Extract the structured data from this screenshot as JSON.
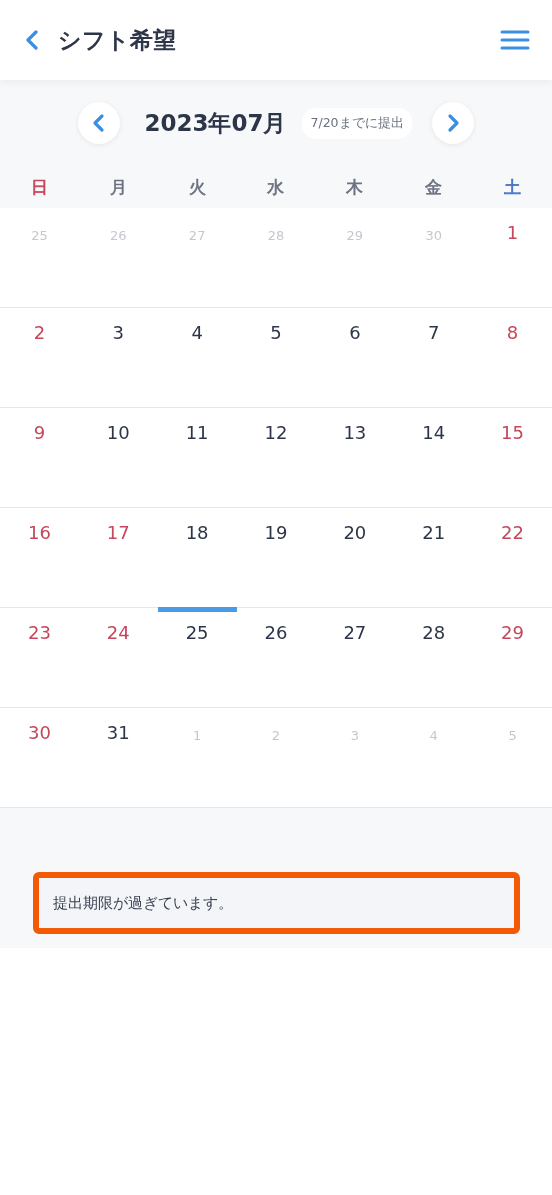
{
  "header": {
    "title": "シフト希望"
  },
  "month_nav": {
    "month": "2023年07月",
    "deadline": "7/20までに提出"
  },
  "weekdays": [
    {
      "label": "日",
      "color": "#c5475a"
    },
    {
      "label": "月",
      "color": "#6b7280"
    },
    {
      "label": "火",
      "color": "#6b7280"
    },
    {
      "label": "水",
      "color": "#6b7280"
    },
    {
      "label": "木",
      "color": "#6b7280"
    },
    {
      "label": "金",
      "color": "#6b7280"
    },
    {
      "label": "土",
      "color": "#3f6fc2"
    }
  ],
  "weeks": [
    [
      {
        "label": "25",
        "kind": "other",
        "color": "#c4c8ce",
        "today": false
      },
      {
        "label": "26",
        "kind": "other",
        "color": "#c4c8ce",
        "today": false
      },
      {
        "label": "27",
        "kind": "other",
        "color": "#c4c8ce",
        "today": false
      },
      {
        "label": "28",
        "kind": "other",
        "color": "#c4c8ce",
        "today": false
      },
      {
        "label": "29",
        "kind": "other",
        "color": "#c4c8ce",
        "today": false
      },
      {
        "label": "30",
        "kind": "other",
        "color": "#c4c8ce",
        "today": false
      },
      {
        "label": "1",
        "kind": "current",
        "color": "#c5475a",
        "today": false
      }
    ],
    [
      {
        "label": "2",
        "kind": "current",
        "color": "#c5475a",
        "today": false
      },
      {
        "label": "3",
        "kind": "current",
        "color": "#2d3648",
        "today": false
      },
      {
        "label": "4",
        "kind": "current",
        "color": "#2d3648",
        "today": false
      },
      {
        "label": "5",
        "kind": "current",
        "color": "#2d3648",
        "today": false
      },
      {
        "label": "6",
        "kind": "current",
        "color": "#2d3648",
        "today": false
      },
      {
        "label": "7",
        "kind": "current",
        "color": "#2d3648",
        "today": false
      },
      {
        "label": "8",
        "kind": "current",
        "color": "#c5475a",
        "today": false
      }
    ],
    [
      {
        "label": "9",
        "kind": "current",
        "color": "#c5475a",
        "today": false
      },
      {
        "label": "10",
        "kind": "current",
        "color": "#2d3648",
        "today": false
      },
      {
        "label": "11",
        "kind": "current",
        "color": "#2d3648",
        "today": false
      },
      {
        "label": "12",
        "kind": "current",
        "color": "#2d3648",
        "today": false
      },
      {
        "label": "13",
        "kind": "current",
        "color": "#2d3648",
        "today": false
      },
      {
        "label": "14",
        "kind": "current",
        "color": "#2d3648",
        "today": false
      },
      {
        "label": "15",
        "kind": "current",
        "color": "#c5475a",
        "today": false
      }
    ],
    [
      {
        "label": "16",
        "kind": "current",
        "color": "#c5475a",
        "today": false
      },
      {
        "label": "17",
        "kind": "current",
        "color": "#c5475a",
        "today": false
      },
      {
        "label": "18",
        "kind": "current",
        "color": "#2d3648",
        "today": false
      },
      {
        "label": "19",
        "kind": "current",
        "color": "#2d3648",
        "today": false
      },
      {
        "label": "20",
        "kind": "current",
        "color": "#2d3648",
        "today": false
      },
      {
        "label": "21",
        "kind": "current",
        "color": "#2d3648",
        "today": false
      },
      {
        "label": "22",
        "kind": "current",
        "color": "#c5475a",
        "today": false
      }
    ],
    [
      {
        "label": "23",
        "kind": "current",
        "color": "#c5475a",
        "today": false
      },
      {
        "label": "24",
        "kind": "current",
        "color": "#c5475a",
        "today": false
      },
      {
        "label": "25",
        "kind": "current",
        "color": "#2d3648",
        "today": true
      },
      {
        "label": "26",
        "kind": "current",
        "color": "#2d3648",
        "today": false
      },
      {
        "label": "27",
        "kind": "current",
        "color": "#2d3648",
        "today": false
      },
      {
        "label": "28",
        "kind": "current",
        "color": "#2d3648",
        "today": false
      },
      {
        "label": "29",
        "kind": "current",
        "color": "#c5475a",
        "today": false
      }
    ],
    [
      {
        "label": "30",
        "kind": "current",
        "color": "#c5475a",
        "today": false
      },
      {
        "label": "31",
        "kind": "current",
        "color": "#2d3648",
        "today": false
      },
      {
        "label": "1",
        "kind": "other",
        "color": "#c4c8ce",
        "today": false
      },
      {
        "label": "2",
        "kind": "other",
        "color": "#c4c8ce",
        "today": false
      },
      {
        "label": "3",
        "kind": "other",
        "color": "#c4c8ce",
        "today": false
      },
      {
        "label": "4",
        "kind": "other",
        "color": "#c4c8ce",
        "today": false
      },
      {
        "label": "5",
        "kind": "other",
        "color": "#c4c8ce",
        "today": false
      }
    ]
  ],
  "notice": "提出期限が過ぎています。"
}
